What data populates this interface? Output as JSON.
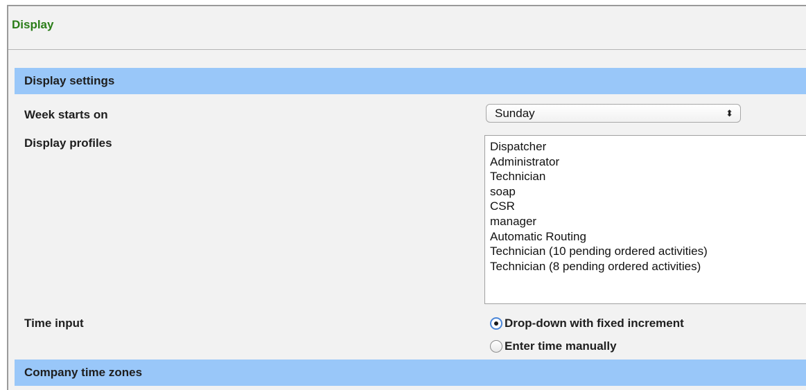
{
  "page": {
    "title": "Display"
  },
  "sections": {
    "display_settings": "Display settings",
    "company_time_zones": "Company time zones"
  },
  "week_start": {
    "label": "Week starts on",
    "value": "Sunday"
  },
  "display_profiles": {
    "label": "Display profiles",
    "options": [
      "Dispatcher",
      "Administrator",
      "Technician",
      "soap",
      "CSR",
      "manager",
      "Automatic Routing",
      "Technician (10 pending ordered activities)",
      "Technician (8 pending ordered activities)"
    ]
  },
  "time_input": {
    "label": "Time input",
    "options": [
      {
        "label": "Drop-down with fixed increment",
        "checked": true
      },
      {
        "label": "Enter time manually",
        "checked": false
      }
    ]
  },
  "colors": {
    "title": "#2a7d18",
    "section_header_bg": "#99c7f9",
    "panel_bg": "#f2f2f2"
  },
  "icons": {
    "select": "select-arrows-icon",
    "radio": "radio-icon"
  }
}
